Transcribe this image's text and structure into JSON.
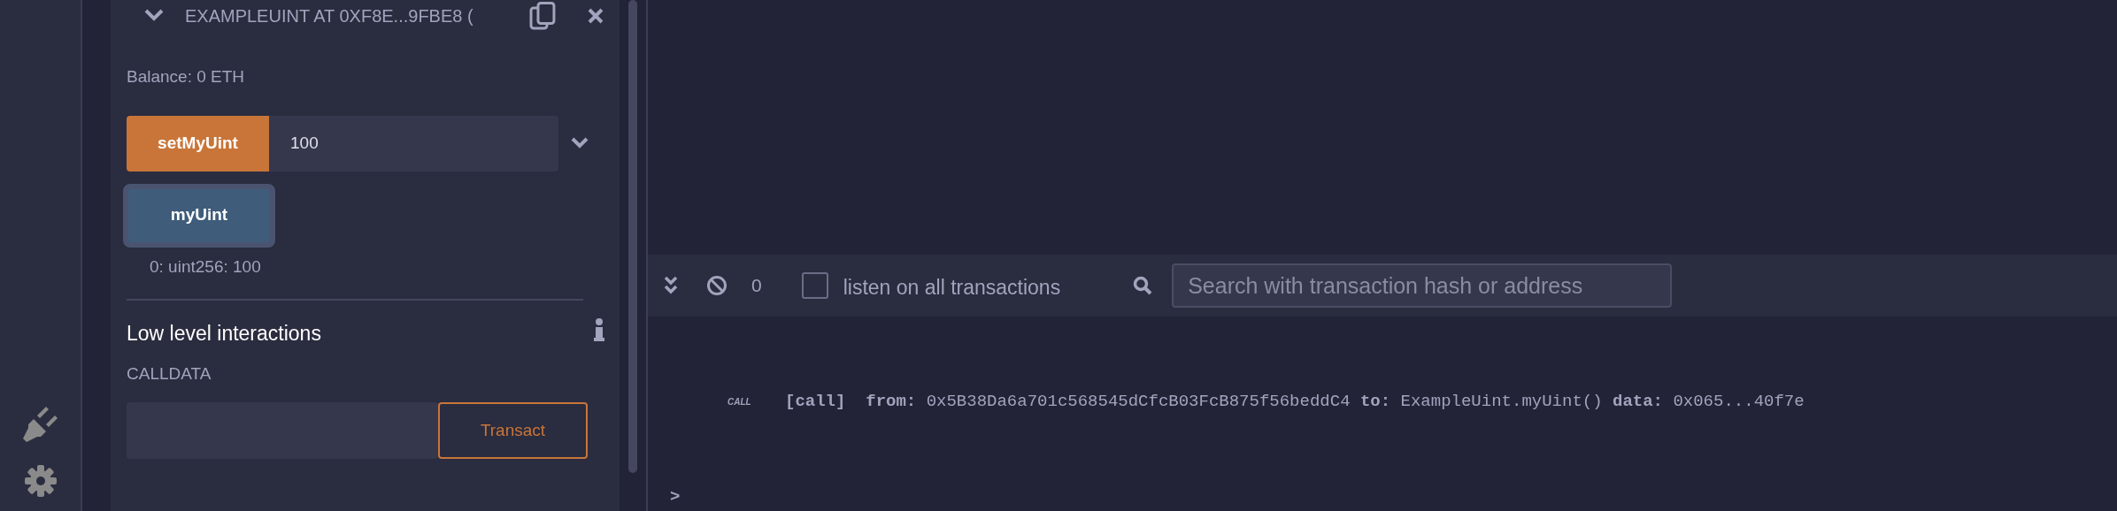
{
  "contract": {
    "title": "EXAMPLEUINT AT 0XF8E...9FBE8 (",
    "expanded": true,
    "balance": "Balance: 0 ETH",
    "functions": [
      {
        "kind": "transact",
        "label": "setMyUint",
        "value": "100"
      },
      {
        "kind": "call",
        "label": "myUint",
        "result": "0: uint256: 100"
      }
    ],
    "low_level": {
      "title": "Low level interactions",
      "calldata_label": "CALLDATA",
      "button": "Transact"
    }
  },
  "terminal": {
    "count": "0",
    "listen_all": {
      "label": "listen on all transactions",
      "checked": false
    },
    "search": {
      "placeholder": "Search with transaction hash or address"
    },
    "logs": [
      {
        "tag": "CALL",
        "text": "**[call]**  **from:** 0x5B38Da6a701c568545dCfcB03FcB875f56beddC4 **to:** ExampleUint.myUint() **data:** 0x065...40f7e"
      }
    ],
    "prompt": ">"
  }
}
